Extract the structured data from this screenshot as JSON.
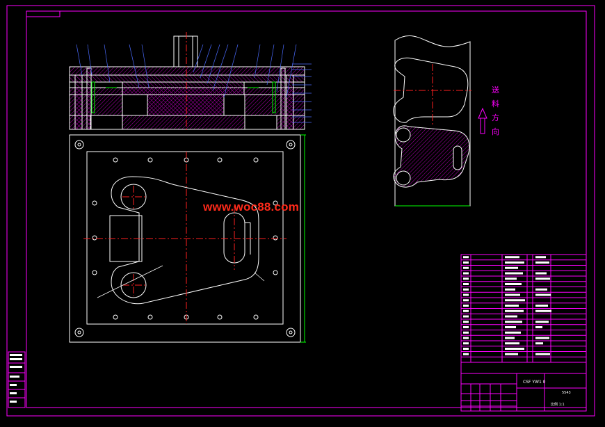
{
  "watermark": "www.woc88.com",
  "feed_label": [
    "送",
    "料",
    "方",
    "向"
  ],
  "title_block": {
    "drawing_no": "CSF YW1 0",
    "company_code": "5543",
    "sheet_note": "比例 1:1"
  },
  "left_stamp": {
    "lines": [
      "描图",
      "描校",
      "底图总号",
      "签字",
      "日期"
    ]
  },
  "colors": {
    "frame": "#ff00ff",
    "part": "#ffffff",
    "center": "#ff2020",
    "hatch": "#c000c0",
    "accent": "#00ff00",
    "note": "#4a6bff",
    "cyan": "#00e0e0"
  }
}
